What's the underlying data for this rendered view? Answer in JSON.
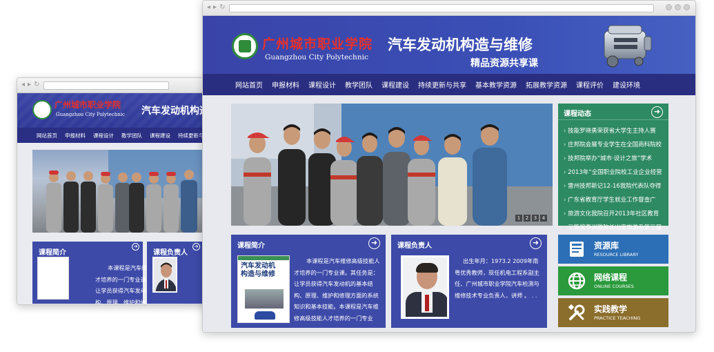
{
  "colors": {
    "banner_blue": "#3a44a8",
    "nav_dark": "#2a2e80",
    "panel_blue": "#3d4aa8",
    "news_green": "#2e8a63",
    "tile_blue": "#2c6fb6",
    "tile_green": "#2a9a3c",
    "tile_brown": "#8b6d2c"
  },
  "site": {
    "school_cn": "广州城市职业学院",
    "school_en": "Guangzhou City Polytechnic",
    "course_title": "汽车发动机构造与维修",
    "course_subtitle": "精品资源共享课"
  },
  "back_window": {
    "course_title": "汽车发动机构造",
    "nav": [
      "网站首页",
      "申报材料",
      "课程设计",
      "教学团队",
      "课程建设",
      "持续更新与共享"
    ],
    "intro_title": "课程简介",
    "lead_title": "课程负责人",
    "intro_text": "本课程是汽车维修高级技能人才培养的一门专业课。其任务是：让学员获得汽车发动机的基本结构、原理、维护和修理方面的系统知识和基本技能。本课程是汽车维修高级技能人才培养的一门专业课。"
  },
  "nav": [
    "网站首页",
    "申报材料",
    "课程设计",
    "教学团队",
    "课程建设",
    "持续更新与共享",
    "基本教学资源",
    "拓展教学资源",
    "课程评价",
    "建设环境"
  ],
  "slider": {
    "pages": [
      "1",
      "2",
      "3",
      "4"
    ]
  },
  "news": {
    "title": "课程动态",
    "items": [
      "技能罗晓勇荣获省大学生主持人赛",
      "庄邦院会展专业学生在全国商科院校",
      "技邦院举办“城市·设计之旅”学术",
      "2013年“全国职业院校工业企业经营",
      "雷州技邦新记12-16我院代表队夺得",
      "广东省教育厅学生就业工作督查广",
      "旅游文化我院召开2013年社区教育",
      "三等奖李训腾院长出席旅游系第三届"
    ]
  },
  "intro": {
    "title": "课程简介",
    "book_title_line1": "汽车发动机",
    "book_title_line2": "构造与维修",
    "text": "本课程是汽车维修高级技能人才培养的一门专业课。其任务是：让学员获得汽车发动机的基本结构、原理、维护和修理方面的系统知识和基本技能。本课程是汽车维修高级技能人才培养的一门专业课。其任务..."
  },
  "lead": {
    "title": "课程负责人",
    "text": "出生年月：1973.2 2009年南粤优秀教师，现任机电工程系副主任、广州城市职业学院汽车检测与维修技术专业负责人，讲师 。 . ."
  },
  "tiles": [
    {
      "title": "资源库",
      "subtitle": "RESOURCE LIBRARY",
      "icon": "book-icon"
    },
    {
      "title": "网络课程",
      "subtitle": "ONLINE COURSES",
      "icon": "globe-icon"
    },
    {
      "title": "实践教学",
      "subtitle": "PRACTICE TEACHING",
      "icon": "tools-icon"
    }
  ]
}
